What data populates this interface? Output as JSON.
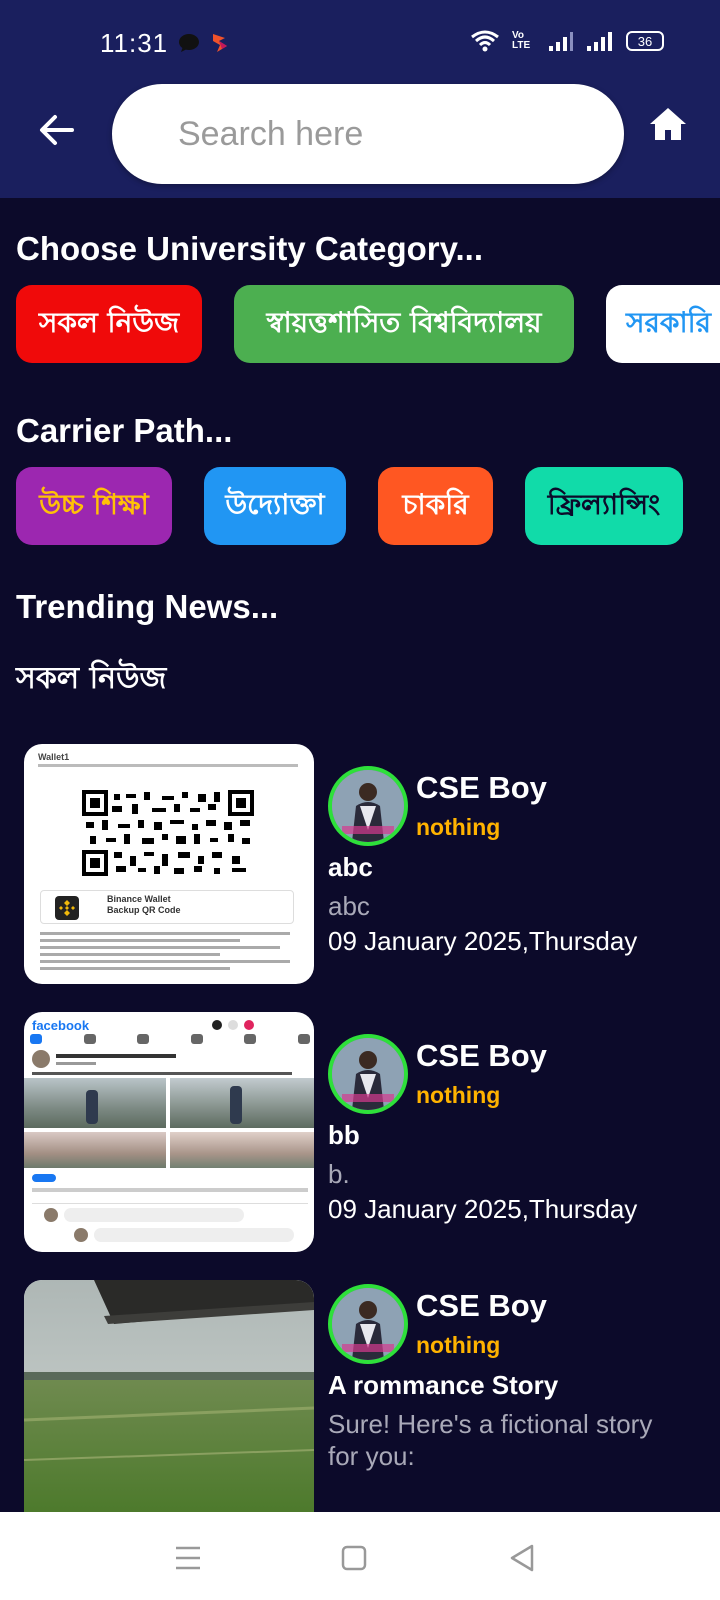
{
  "status": {
    "time": "11:31",
    "battery": "36",
    "volte": "Vo LTE"
  },
  "search": {
    "placeholder": "Search here"
  },
  "sections": {
    "university": "Choose University Category...",
    "career": "Carrier Path...",
    "trending": "Trending News...",
    "all_news_bn": "সকল নিউজ"
  },
  "university_chips": [
    {
      "label": "সকল নিউজ",
      "bg": "#f00a0a",
      "fg": "#ffffff"
    },
    {
      "label": "স্বায়ত্তশাসিত বিশ্ববিদ্যালয়",
      "bg": "#4caf50",
      "fg": "#ffffff"
    },
    {
      "label": "সরকারি",
      "bg": "#ffffff",
      "fg": "#2196f3"
    }
  ],
  "career_chips": [
    {
      "label": "উচ্চ শিক্ষা",
      "bg": "#9c27b0",
      "fg": "#ffc107"
    },
    {
      "label": "উদ্যোক্তা",
      "bg": "#2196f3",
      "fg": "#ffffff"
    },
    {
      "label": "চাকরি",
      "bg": "#ff5722",
      "fg": "#ffffff"
    },
    {
      "label": "ফ্রিল্যান্সিং",
      "bg": "#11dba9",
      "fg": "#0c0a2a"
    }
  ],
  "news": [
    {
      "author": "CSE Boy",
      "role": "nothing",
      "title": "abc",
      "desc": "abc",
      "date": "09 January 2025,Thursday",
      "thumb_type": "qr",
      "thumb_text": {
        "wallet": "Wallet1",
        "card_title": "Binance Wallet",
        "card_sub": "Backup QR Code"
      }
    },
    {
      "author": "CSE Boy",
      "role": "nothing",
      "title": "bb",
      "desc": "b.",
      "date": "09 January 2025,Thursday",
      "thumb_type": "facebook",
      "thumb_text": {
        "brand": "facebook"
      }
    },
    {
      "author": "CSE Boy",
      "role": "nothing",
      "title": "A rommance Story",
      "desc": "Sure! Here's a fictional story for you:",
      "date": "",
      "thumb_type": "field"
    }
  ],
  "colors": {
    "header": "#1a1f5e",
    "background": "#0c0a2a",
    "avatar_ring": "#2ee03a",
    "role": "#ffb300"
  }
}
